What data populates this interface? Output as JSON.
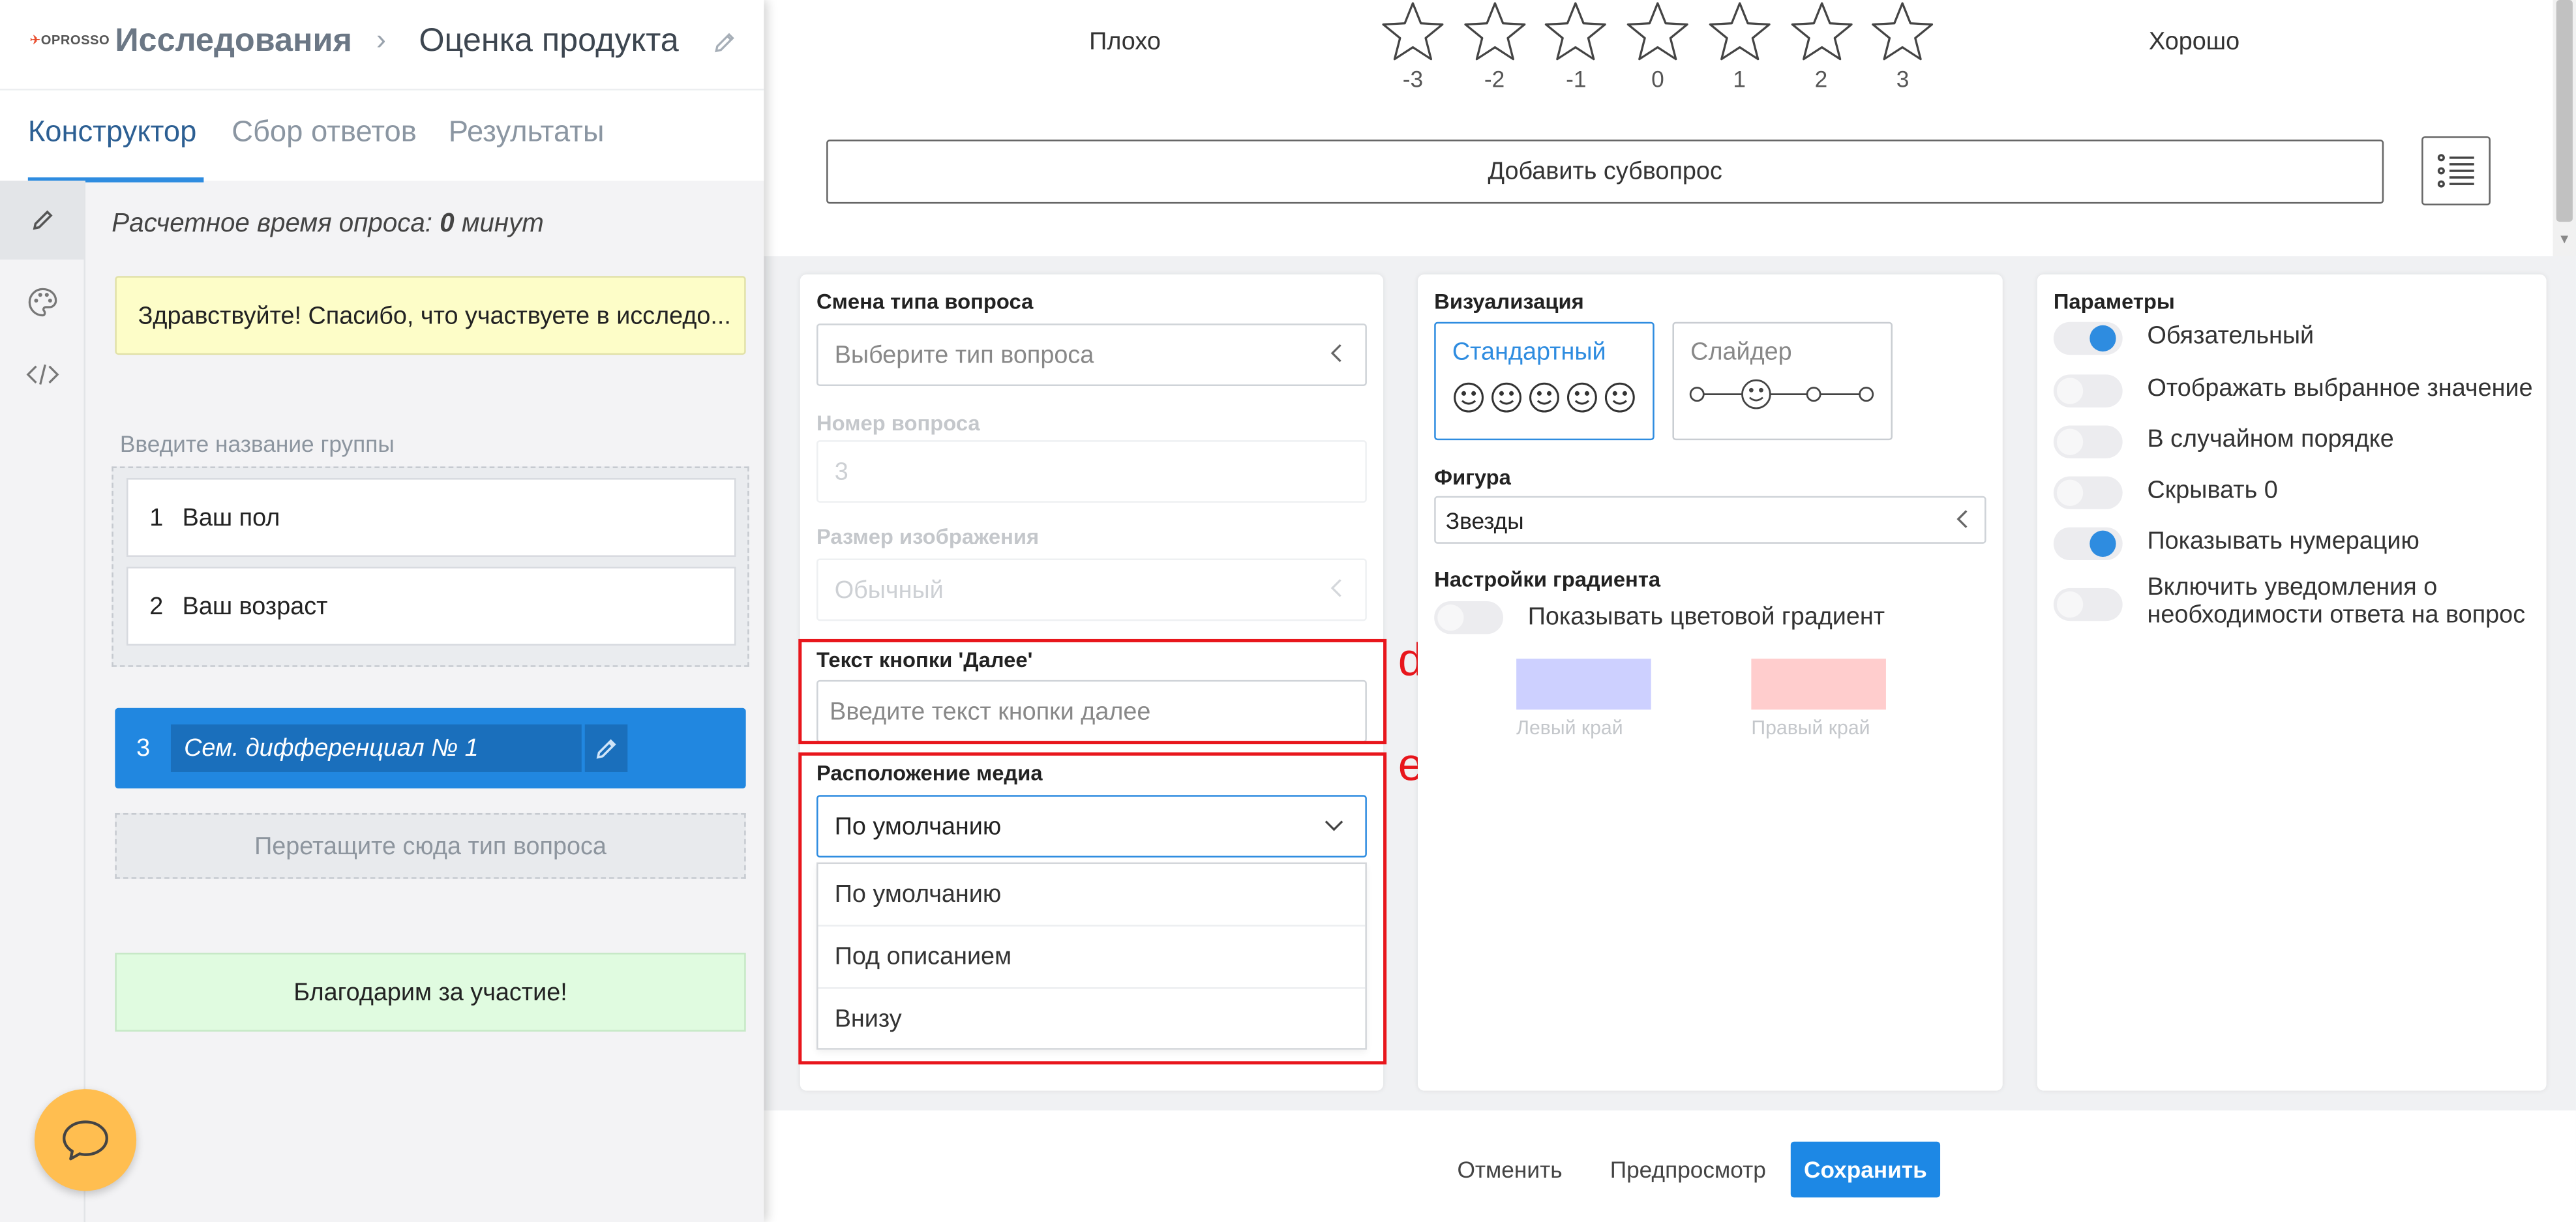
{
  "header": {
    "logo_text": "OPROSSO",
    "breadcrumb_root": "Исследования",
    "breadcrumb_separator": "›",
    "breadcrumb_current": "Оценка продукта"
  },
  "tabs": [
    {
      "label": "Конструктор",
      "active": true
    },
    {
      "label": "Сбор ответов",
      "active": false
    },
    {
      "label": "Результаты",
      "active": false
    }
  ],
  "survey": {
    "estimated_time_prefix": "Расчетное время опроса:",
    "estimated_time_value": "0",
    "estimated_time_unit": "минут",
    "welcome_text": "Здравствуйте! Спасибо, что участвуете в исследо...",
    "group_placeholder": "Введите название группы",
    "group_questions": [
      {
        "num": "1",
        "title": "Ваш пол"
      },
      {
        "num": "2",
        "title": "Ваш возраст"
      }
    ],
    "active_question": {
      "num": "3",
      "title": "Сем. дифференциал № 1"
    },
    "drop_zone_text": "Перетащите сюда тип вопроса",
    "thanks_text": "Благодарим за участие!"
  },
  "preview": {
    "left_label": "Плохо",
    "right_label": "Хорошо",
    "scale": [
      "-3",
      "-2",
      "-1",
      "0",
      "1",
      "2",
      "3"
    ],
    "add_subquestion_label": "Добавить субвопрос"
  },
  "question_settings": {
    "type_label": "Смена типа вопроса",
    "type_placeholder": "Выберите тип вопроса",
    "number_label": "Номер вопроса",
    "number_value": "3",
    "image_size_label": "Размер изображения",
    "image_size_value": "Обычный",
    "next_button_label": "Текст кнопки 'Далее'",
    "next_button_placeholder": "Введите текст кнопки далее",
    "media_position_label": "Расположение медиа",
    "media_position_value": "По умолчанию",
    "media_options": [
      "По умолчанию",
      "Под описанием",
      "Внизу"
    ],
    "annotation_d": "d",
    "annotation_e": "e"
  },
  "visualization": {
    "title": "Визуализация",
    "standard_label": "Стандартный",
    "slider_label": "Слайдер",
    "shape_label": "Фигура",
    "shape_value": "Звезды",
    "gradient_title": "Настройки градиента",
    "gradient_toggle_label": "Показывать цветовой градиент",
    "left_edge_label": "Левый край",
    "right_edge_label": "Правый край",
    "left_edge_color": "#cdd0ff",
    "right_edge_color": "#ffcdcd"
  },
  "parameters": {
    "title": "Параметры",
    "items": [
      {
        "label": "Обязательный",
        "on": true
      },
      {
        "label": "Отображать выбранное значение",
        "on": false
      },
      {
        "label": "В случайном порядке",
        "on": false
      },
      {
        "label": "Скрывать 0",
        "on": false
      },
      {
        "label": "Показывать нумерацию",
        "on": true
      },
      {
        "label": "Включить уведомления о необходимости ответа на вопрос",
        "on": false
      }
    ]
  },
  "footer": {
    "cancel_label": "Отменить",
    "preview_label": "Предпросмотр",
    "save_label": "Сохранить"
  },
  "colors": {
    "accent": "#1d88e5",
    "highlight": "#e8161c",
    "welcome_bg": "#fdfdc8",
    "thanks_bg": "#e0fbe0",
    "chat_button": "#ffbe50"
  }
}
